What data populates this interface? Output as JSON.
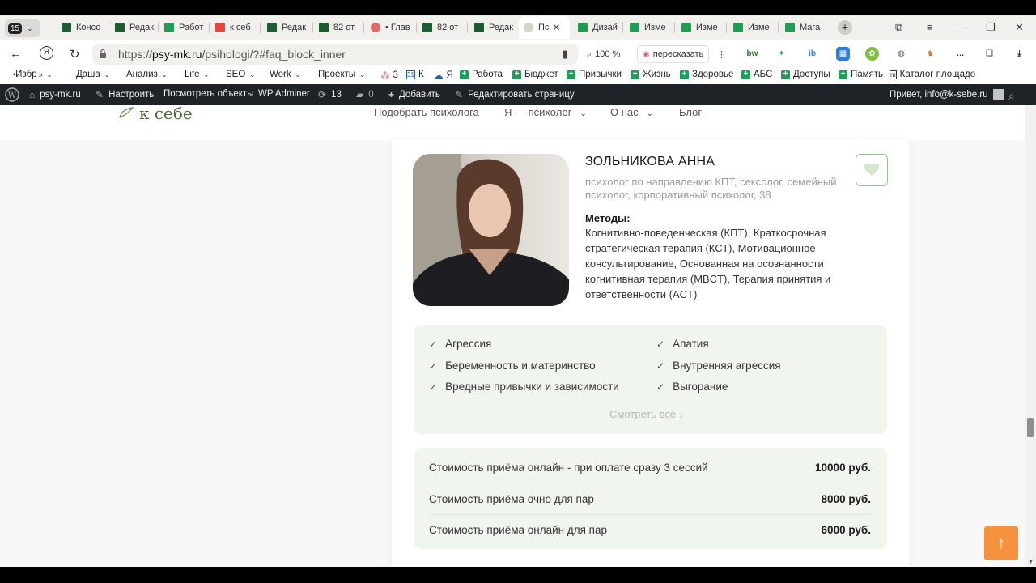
{
  "browser": {
    "tab_count": "15",
    "tabs": [
      {
        "label": "Консо",
        "color": "#1d5c2e"
      },
      {
        "label": "Редак",
        "color": "#1d5c2e"
      },
      {
        "label": "Работ",
        "color": "#1f9d57"
      },
      {
        "label": "к себ",
        "color": "#e8453c"
      },
      {
        "label": "Редак",
        "color": "#1d5c2e"
      },
      {
        "label": "82 от",
        "color": "#1d5c2e"
      },
      {
        "label": "• Глав",
        "color": "#e06b6b"
      },
      {
        "label": "82 от",
        "color": "#1d5c2e"
      },
      {
        "label": "Редак",
        "color": "#1d5c2e"
      },
      {
        "label": "Пс",
        "color": "#cfd9c7"
      },
      {
        "label": "Дизай",
        "color": "#1f9d57"
      },
      {
        "label": "Изме",
        "color": "#1f9d57"
      },
      {
        "label": "Изме",
        "color": "#1f9d57"
      },
      {
        "label": "Изме",
        "color": "#1f9d57"
      },
      {
        "label": "Мага",
        "color": "#1f9d57"
      }
    ],
    "url_prefix": "https://",
    "url_domain": "psy-mk.ru",
    "url_path": "/psihologi/?#faq_block_inner",
    "zoom": "100 %",
    "retell": "пересказать",
    "bookmarks": [
      {
        "label": "Избр",
        "dropdown": true
      },
      {
        "label": "Даша",
        "dropdown": true
      },
      {
        "label": "Анализ",
        "dropdown": true
      },
      {
        "label": "Life",
        "dropdown": true
      },
      {
        "label": "SEO",
        "dropdown": true
      },
      {
        "label": "Work",
        "dropdown": true
      },
      {
        "label": "Проекты",
        "dropdown": true
      },
      {
        "label": "3"
      },
      {
        "label": "К"
      },
      {
        "label": "Я"
      },
      {
        "label": "Работа"
      },
      {
        "label": "Бюджет"
      },
      {
        "label": "Привычки"
      },
      {
        "label": "Жизнь"
      },
      {
        "label": "Здоровье"
      },
      {
        "label": "АБС"
      },
      {
        "label": "Доступы"
      },
      {
        "label": "Память"
      },
      {
        "label": "Каталог площадо"
      }
    ]
  },
  "wpbar": {
    "site": "psy-mk.ru",
    "customize": "Настроить",
    "view_objects": "Посмотреть объекты",
    "adminer": "WP Adminer",
    "updates": "13",
    "comments": "0",
    "add": "Добавить",
    "edit_page": "Редактировать страницу",
    "greeting": "Привет, info@k-sebe.ru"
  },
  "site": {
    "logo": "к себе",
    "menu": [
      "Подобрать психолога",
      "Я — психолог",
      "О нас",
      "Блог"
    ]
  },
  "card": {
    "name": "ЗОЛЬНИКОВА АННА",
    "specialization": "психолог по направлению КПТ, сексолог, семейный психолог, корпоративный психолог, 38",
    "methods_heading": "Методы:",
    "methods_text": "Когнитивно-поведенческая (КПТ), Краткосрочная стратегическая терапия (КСТ), Мотивационное консультирование, Основанная на осознанности когнитивная терапия (MBCT), Терапия принятия и ответственности (ACT)",
    "problems": [
      "Агрессия",
      "Апатия",
      "Беременность и материнство",
      "Внутренняя агрессия",
      "Вредные привычки и зависимости",
      "Выгорание"
    ],
    "see_all": "Смотреть все",
    "prices": [
      {
        "label": "Стоимость приёма онлайн - при оплате сразу 3 сессий",
        "value": "10000 руб."
      },
      {
        "label": "Стоимость приёма очно для пар",
        "value": "8000 руб."
      },
      {
        "label": "Стоимость приёма онлайн для пар",
        "value": "6000 руб."
      }
    ]
  },
  "colors": {
    "accent": "#f5923e",
    "green": "#4c6a3a",
    "panel": "#f0f6ee"
  }
}
